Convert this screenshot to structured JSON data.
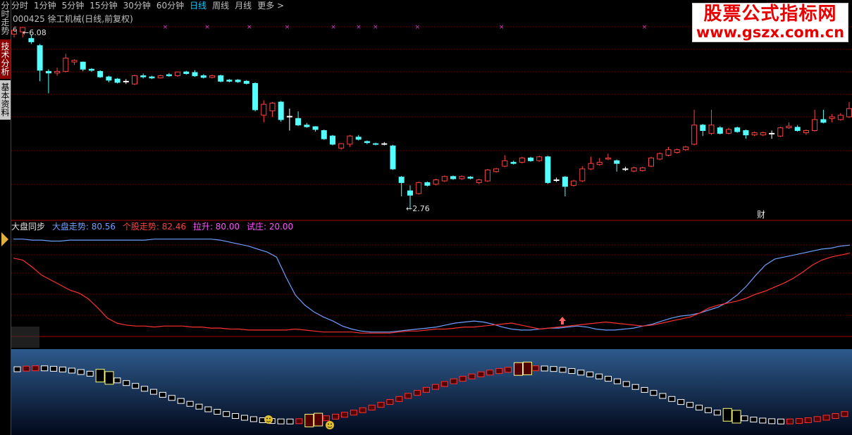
{
  "left_tabs": [
    {
      "label": "分时走势",
      "bg": "#000000",
      "fg": "#c0c0c0"
    },
    {
      "label": "技术分析",
      "bg": "#8b0000",
      "fg": "#ffffff"
    },
    {
      "label": "基本资料",
      "bg": "#c8c8c8",
      "fg": "#000000"
    }
  ],
  "top_menu": {
    "items": [
      "分时",
      "1分钟",
      "5分钟",
      "15分钟",
      "30分钟",
      "60分钟",
      "日线",
      "周线",
      "月线",
      "更多 >"
    ],
    "active": "日线"
  },
  "stock": {
    "code_name": "000425 徐工机械(日线,前复权)",
    "high_label": "6.08",
    "high_prefix": "6",
    "low_label": "2.76",
    "cai_label": "财"
  },
  "indicator": {
    "name": "大盘同步",
    "items": [
      {
        "label": "大盘走势: 80.56",
        "color": "#6f9fff"
      },
      {
        "label": "个股走势: 82.46",
        "color": "#ff3f3f"
      },
      {
        "label": "拉升: 80.00",
        "color": "#ff55ff"
      },
      {
        "label": "试庄: 20.00",
        "color": "#ff55ff"
      }
    ]
  },
  "watermark": {
    "title": "股票公式指标网",
    "url": "www.gszx.com.cn"
  },
  "colors": {
    "up": "#ff4040",
    "down": "#54ffff",
    "grid": "#800000",
    "index_line": "#6f9fff",
    "stock_line": "#ff3030"
  },
  "chart_data": [
    {
      "type": "candlestick",
      "title": "000425 徐工机械(日线,前复权)",
      "ylim": [
        2.6,
        6.3
      ],
      "candles": [
        {
          "o": 5.96,
          "c": 6.03,
          "h": 6.05,
          "l": 5.9
        },
        {
          "o": 6.0,
          "c": 6.08,
          "h": 6.08,
          "l": 5.9
        },
        {
          "o": 5.88,
          "c": 5.82,
          "h": 5.95,
          "l": 5.78
        },
        {
          "o": 5.75,
          "c": 5.3,
          "h": 5.78,
          "l": 5.1
        },
        {
          "o": 5.28,
          "c": 5.25,
          "h": 5.32,
          "l": 4.88
        },
        {
          "o": 5.25,
          "c": 5.28,
          "h": 5.35,
          "l": 5.2
        },
        {
          "o": 5.28,
          "c": 5.52,
          "h": 5.6,
          "l": 5.26
        },
        {
          "o": 5.45,
          "c": 5.48,
          "h": 5.5,
          "l": 5.4
        },
        {
          "o": 5.45,
          "c": 5.32,
          "h": 5.46,
          "l": 5.28
        },
        {
          "o": 5.32,
          "c": 5.3,
          "h": 5.34,
          "l": 5.27
        },
        {
          "o": 5.28,
          "c": 5.18,
          "h": 5.3,
          "l": 5.16
        },
        {
          "o": 5.18,
          "c": 5.12,
          "h": 5.2,
          "l": 5.08
        },
        {
          "o": 5.14,
          "c": 5.08,
          "h": 5.16,
          "l": 5.06
        },
        {
          "o": 5.1,
          "c": 5.1,
          "h": 5.14,
          "l": 5.05
        },
        {
          "o": 5.05,
          "c": 5.2,
          "h": 5.22,
          "l": 5.03
        },
        {
          "o": 5.2,
          "c": 5.18,
          "h": 5.24,
          "l": 5.15
        },
        {
          "o": 5.18,
          "c": 5.16,
          "h": 5.2,
          "l": 5.14
        },
        {
          "o": 5.16,
          "c": 5.2,
          "h": 5.22,
          "l": 5.15
        },
        {
          "o": 5.22,
          "c": 5.2,
          "h": 5.25,
          "l": 5.18
        },
        {
          "o": 5.2,
          "c": 5.27,
          "h": 5.28,
          "l": 5.18
        },
        {
          "o": 5.27,
          "c": 5.24,
          "h": 5.29,
          "l": 5.22
        },
        {
          "o": 5.26,
          "c": 5.2,
          "h": 5.3,
          "l": 5.18
        },
        {
          "o": 5.2,
          "c": 5.17,
          "h": 5.23,
          "l": 5.15
        },
        {
          "o": 5.17,
          "c": 5.2,
          "h": 5.22,
          "l": 5.15
        },
        {
          "o": 5.2,
          "c": 5.1,
          "h": 5.22,
          "l": 5.08
        },
        {
          "o": 5.12,
          "c": 5.1,
          "h": 5.14,
          "l": 5.08
        },
        {
          "o": 5.12,
          "c": 5.09,
          "h": 5.14,
          "l": 5.07
        },
        {
          "o": 5.1,
          "c": 5.06,
          "h": 5.12,
          "l": 5.04
        },
        {
          "o": 5.06,
          "c": 4.58,
          "h": 5.08,
          "l": 4.55
        },
        {
          "o": 4.48,
          "c": 4.68,
          "h": 4.75,
          "l": 4.35
        },
        {
          "o": 4.56,
          "c": 4.7,
          "h": 4.72,
          "l": 4.45
        },
        {
          "o": 4.72,
          "c": 4.4,
          "h": 4.74,
          "l": 4.36
        },
        {
          "o": 4.46,
          "c": 4.46,
          "h": 4.6,
          "l": 4.2
        },
        {
          "o": 4.42,
          "c": 4.3,
          "h": 4.55,
          "l": 4.28
        },
        {
          "o": 4.3,
          "c": 4.27,
          "h": 4.34,
          "l": 4.25
        },
        {
          "o": 4.27,
          "c": 4.22,
          "h": 4.28,
          "l": 4.18
        },
        {
          "o": 4.2,
          "c": 4.05,
          "h": 4.22,
          "l": 4.03
        },
        {
          "o": 4.1,
          "c": 3.95,
          "h": 4.12,
          "l": 3.93
        },
        {
          "o": 3.88,
          "c": 3.96,
          "h": 3.97,
          "l": 3.85
        },
        {
          "o": 3.95,
          "c": 4.1,
          "h": 4.12,
          "l": 3.9
        },
        {
          "o": 4.08,
          "c": 4.04,
          "h": 4.12,
          "l": 4.02
        },
        {
          "o": 4.0,
          "c": 3.98,
          "h": 4.02,
          "l": 3.95
        },
        {
          "o": 3.96,
          "c": 3.95,
          "h": 3.98,
          "l": 3.93
        },
        {
          "o": 3.96,
          "c": 3.96,
          "h": 3.99,
          "l": 3.93
        },
        {
          "o": 3.92,
          "c": 3.5,
          "h": 3.94,
          "l": 3.48
        },
        {
          "o": 3.35,
          "c": 3.25,
          "h": 3.37,
          "l": 3.0
        },
        {
          "o": 3.1,
          "c": 3.02,
          "h": 3.2,
          "l": 2.76
        },
        {
          "o": 3.05,
          "c": 3.25,
          "h": 3.27,
          "l": 3.03
        },
        {
          "o": 3.25,
          "c": 3.2,
          "h": 3.27,
          "l": 3.18
        },
        {
          "o": 3.22,
          "c": 3.3,
          "h": 3.32,
          "l": 3.2
        },
        {
          "o": 3.28,
          "c": 3.36,
          "h": 3.38,
          "l": 3.26
        },
        {
          "o": 3.36,
          "c": 3.32,
          "h": 3.38,
          "l": 3.3
        },
        {
          "o": 3.32,
          "c": 3.36,
          "h": 3.38,
          "l": 3.3
        },
        {
          "o": 3.35,
          "c": 3.33,
          "h": 3.37,
          "l": 3.31
        },
        {
          "o": 3.25,
          "c": 3.3,
          "h": 3.32,
          "l": 3.22
        },
        {
          "o": 3.28,
          "c": 3.48,
          "h": 3.5,
          "l": 3.26
        },
        {
          "o": 3.45,
          "c": 3.5,
          "h": 3.52,
          "l": 3.43
        },
        {
          "o": 3.55,
          "c": 3.65,
          "h": 3.75,
          "l": 3.53
        },
        {
          "o": 3.62,
          "c": 3.6,
          "h": 3.65,
          "l": 3.58
        },
        {
          "o": 3.62,
          "c": 3.7,
          "h": 3.72,
          "l": 3.6
        },
        {
          "o": 3.7,
          "c": 3.65,
          "h": 3.72,
          "l": 3.63
        },
        {
          "o": 3.65,
          "c": 3.72,
          "h": 3.74,
          "l": 3.63
        },
        {
          "o": 3.72,
          "c": 3.25,
          "h": 3.74,
          "l": 3.23
        },
        {
          "o": 3.3,
          "c": 3.3,
          "h": 3.34,
          "l": 3.26
        },
        {
          "o": 3.35,
          "c": 3.18,
          "h": 3.37,
          "l": 3.0
        },
        {
          "o": 3.2,
          "c": 3.28,
          "h": 3.3,
          "l": 3.18
        },
        {
          "o": 3.28,
          "c": 3.5,
          "h": 3.55,
          "l": 3.26
        },
        {
          "o": 3.5,
          "c": 3.6,
          "h": 3.72,
          "l": 3.48
        },
        {
          "o": 3.58,
          "c": 3.62,
          "h": 3.7,
          "l": 3.56
        },
        {
          "o": 3.68,
          "c": 3.7,
          "h": 3.78,
          "l": 3.66
        },
        {
          "o": 3.65,
          "c": 3.6,
          "h": 3.67,
          "l": 3.45
        },
        {
          "o": 3.5,
          "c": 3.5,
          "h": 3.54,
          "l": 3.46
        },
        {
          "o": 3.46,
          "c": 3.52,
          "h": 3.54,
          "l": 3.44
        },
        {
          "o": 3.47,
          "c": 3.52,
          "h": 3.54,
          "l": 3.45
        },
        {
          "o": 3.55,
          "c": 3.7,
          "h": 3.72,
          "l": 3.53
        },
        {
          "o": 3.68,
          "c": 3.78,
          "h": 3.8,
          "l": 3.66
        },
        {
          "o": 3.75,
          "c": 3.85,
          "h": 3.9,
          "l": 3.73
        },
        {
          "o": 3.8,
          "c": 3.85,
          "h": 3.87,
          "l": 3.78
        },
        {
          "o": 3.85,
          "c": 3.9,
          "h": 3.92,
          "l": 3.83
        },
        {
          "o": 3.95,
          "c": 4.3,
          "h": 4.58,
          "l": 3.93
        },
        {
          "o": 4.3,
          "c": 4.2,
          "h": 4.32,
          "l": 4.1
        },
        {
          "o": 4.15,
          "c": 4.3,
          "h": 4.58,
          "l": 4.12
        },
        {
          "o": 4.25,
          "c": 4.15,
          "h": 4.28,
          "l": 4.13
        },
        {
          "o": 4.15,
          "c": 4.22,
          "h": 4.25,
          "l": 4.13
        },
        {
          "o": 4.25,
          "c": 4.18,
          "h": 4.27,
          "l": 4.16
        },
        {
          "o": 4.2,
          "c": 4.12,
          "h": 4.22,
          "l": 4.05
        },
        {
          "o": 4.12,
          "c": 4.16,
          "h": 4.18,
          "l": 4.1
        },
        {
          "o": 4.12,
          "c": 4.16,
          "h": 4.18,
          "l": 4.1
        },
        {
          "o": 4.15,
          "c": 4.15,
          "h": 4.2,
          "l": 4.05
        },
        {
          "o": 4.1,
          "c": 4.25,
          "h": 4.27,
          "l": 4.08
        },
        {
          "o": 4.25,
          "c": 4.28,
          "h": 4.35,
          "l": 4.23
        },
        {
          "o": 4.26,
          "c": 4.2,
          "h": 4.3,
          "l": 4.18
        },
        {
          "o": 4.16,
          "c": 4.2,
          "h": 4.22,
          "l": 4.12
        },
        {
          "o": 4.2,
          "c": 4.4,
          "h": 4.58,
          "l": 4.18
        },
        {
          "o": 4.4,
          "c": 4.35,
          "h": 4.58,
          "l": 4.33
        },
        {
          "o": 4.42,
          "c": 4.45,
          "h": 4.5,
          "l": 4.35
        },
        {
          "o": 4.4,
          "c": 4.48,
          "h": 4.52,
          "l": 4.38
        },
        {
          "o": 4.45,
          "c": 4.6,
          "h": 4.72,
          "l": 4.43
        }
      ]
    },
    {
      "type": "line",
      "title": "大盘同步",
      "ylim": [
        0,
        100
      ],
      "series": [
        {
          "name": "大盘走势",
          "values": [
            96,
            96,
            95,
            95,
            94,
            94,
            95,
            95,
            95,
            95,
            95,
            95,
            95,
            95,
            95,
            96,
            96,
            96,
            96,
            96,
            96,
            96,
            95,
            93,
            91,
            89,
            86,
            83,
            78,
            58,
            40,
            30,
            23,
            18,
            14,
            9,
            6,
            4,
            3,
            3,
            3,
            4,
            5,
            6,
            7,
            8,
            10,
            12,
            13,
            14,
            13,
            11,
            8,
            6,
            5,
            5,
            6,
            7,
            7,
            8,
            9,
            8,
            6,
            5,
            5,
            6,
            7,
            9,
            11,
            14,
            17,
            19,
            20,
            22,
            25,
            28,
            33,
            40,
            49,
            60,
            70,
            76,
            78,
            80,
            82,
            84,
            86,
            87,
            89,
            90
          ]
        },
        {
          "name": "个股走势",
          "values": [
            77,
            75,
            68,
            60,
            55,
            50,
            45,
            42,
            36,
            27,
            17,
            12,
            10,
            9,
            9,
            8,
            9,
            9,
            9,
            8,
            8,
            7,
            7,
            6,
            6,
            5,
            5,
            5,
            5,
            5,
            6,
            5,
            4,
            3,
            3,
            3,
            3,
            2,
            2,
            2,
            2,
            3,
            4,
            4,
            5,
            6,
            6,
            7,
            8,
            8,
            9,
            10,
            11,
            12,
            10,
            8,
            6,
            7,
            8,
            9,
            10,
            11,
            12,
            13,
            12,
            11,
            10,
            9,
            10,
            12,
            14,
            16,
            18,
            22,
            27,
            30,
            32,
            34,
            37,
            41,
            44,
            48,
            52,
            57,
            63,
            70,
            75,
            78,
            80,
            82
          ]
        }
      ]
    }
  ]
}
